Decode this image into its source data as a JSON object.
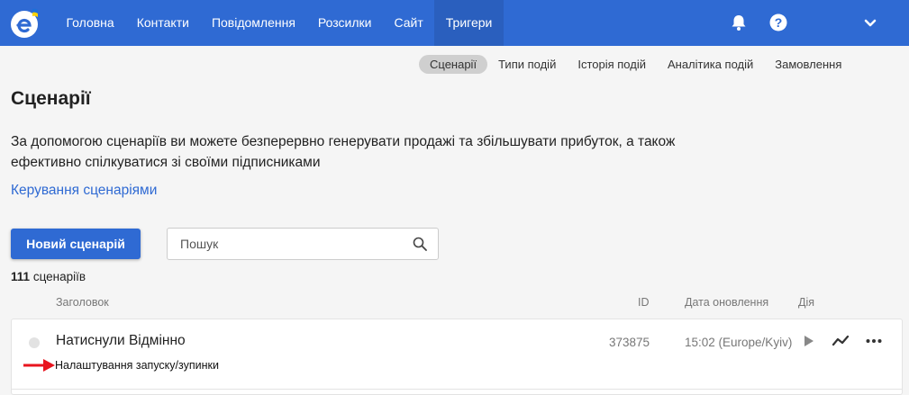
{
  "nav": {
    "items": [
      {
        "label": "Головна"
      },
      {
        "label": "Контакти"
      },
      {
        "label": "Повідомлення"
      },
      {
        "label": "Розсилки"
      },
      {
        "label": "Сайт"
      },
      {
        "label": "Тригери",
        "active": true
      }
    ],
    "icons": [
      "bell-icon",
      "help-icon",
      "chevron-down-icon"
    ]
  },
  "subnav": {
    "items": [
      {
        "label": "Сценарії",
        "active": true
      },
      {
        "label": "Типи подій"
      },
      {
        "label": "Історія подій"
      },
      {
        "label": "Аналітика подій"
      },
      {
        "label": "Замовлення"
      }
    ]
  },
  "page": {
    "title": "Сценарії",
    "description": "За допомогою сценаріїв ви можете безперервно генерувати продажі та збільшувати прибуток, а також ефективно спілкуватися зі своїми підписниками",
    "manage_link": "Керування сценаріями"
  },
  "toolbar": {
    "new_button": "Новий сценарій",
    "search_placeholder": "Пошук"
  },
  "list": {
    "count": "111",
    "count_label": "сценаріїв",
    "columns": {
      "title": "Заголовок",
      "id": "ID",
      "updated": "Дата оновлення",
      "action": "Дія"
    },
    "rows": [
      {
        "title": "Натиснули Відмінно",
        "id": "373875",
        "updated": "15:02 (Europe/Kyiv)",
        "status": "inactive"
      }
    ]
  },
  "annotation": {
    "text": "Налаштування запуску/зупинки",
    "arrow_color": "#e8141e"
  },
  "colors": {
    "brand": "#2f6ad3",
    "nav_active": "#2a5fbe"
  }
}
